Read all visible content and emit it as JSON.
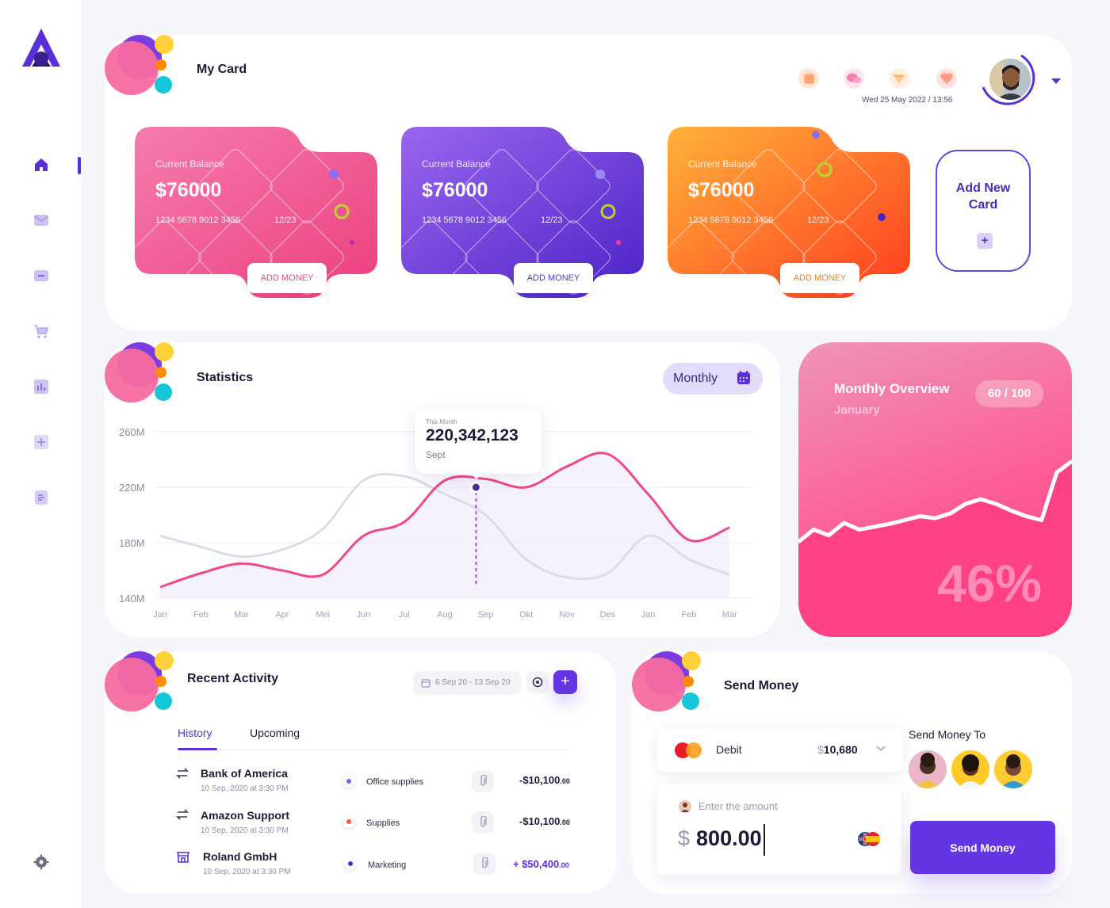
{
  "sidebar": {
    "items": [
      {
        "name": "home",
        "icon": "home-icon"
      },
      {
        "name": "messages",
        "icon": "mail-icon"
      },
      {
        "name": "wallet",
        "icon": "wallet-icon"
      },
      {
        "name": "cart",
        "icon": "cart-icon"
      },
      {
        "name": "analytics",
        "icon": "bar-chart-icon"
      },
      {
        "name": "add",
        "icon": "plus-icon"
      },
      {
        "name": "documents",
        "icon": "document-icon"
      }
    ],
    "settings_icon": "gear-icon"
  },
  "my_card": {
    "title": "My Card",
    "cards": [
      {
        "label": "Current Balance",
        "balance": "$76000",
        "number": "1234 5678 9012 3456",
        "expiry": "12/23",
        "button": "ADD MONEY",
        "accent": "#f0477e"
      },
      {
        "label": "Current Balance",
        "balance": "$76000",
        "number": "1234 5678 9012 3456",
        "expiry": "12/23",
        "button": "ADD MONEY",
        "accent": "#5a2fd8"
      },
      {
        "label": "Current Balance",
        "balance": "$76000",
        "number": "1234 5678 9012 3456",
        "expiry": "12/23",
        "button": "ADD MONEY",
        "accent": "#ff7a1a"
      }
    ],
    "add_new_card": "Add New Card",
    "add_new_card_plus": "+"
  },
  "header": {
    "datetime": "Wed 25 May 2022 / 13:56",
    "icons": [
      "calendar-icon",
      "chat-icon",
      "notification-icon",
      "heart-icon"
    ]
  },
  "statistics": {
    "title": "Statistics",
    "period_button": "Monthly",
    "tooltip": {
      "caption": "This Month",
      "value": "220,342,123",
      "month": "Sept"
    }
  },
  "chart_data": {
    "type": "line",
    "categories": [
      "Jan",
      "Feb",
      "Mar",
      "Apr",
      "Mei",
      "Jun",
      "Jul",
      "Aug",
      "Sep",
      "Okt",
      "Nov",
      "Des",
      "Jan",
      "Feb",
      "Mar"
    ],
    "y_ticks": [
      "260M",
      "220M",
      "180M",
      "140M"
    ],
    "ylim": [
      140,
      260
    ],
    "series": [
      {
        "color": "#f0478c",
        "values": [
          148,
          158,
          165,
          160,
          157,
          185,
          195,
          225,
          226,
          220,
          235,
          244,
          215,
          182,
          191
        ]
      },
      {
        "color": "#dcdce8",
        "values": [
          185,
          177,
          170,
          175,
          190,
          225,
          228,
          215,
          200,
          168,
          155,
          158,
          185,
          168,
          157
        ]
      }
    ],
    "highlight": {
      "category": "Sep",
      "value": 220
    }
  },
  "overview": {
    "title": "Monthly Overview",
    "subtitle": "January",
    "score": "60 / 100",
    "percent": "46%",
    "trend": [
      0.15,
      0.28,
      0.22,
      0.35,
      0.28,
      0.31,
      0.34,
      0.38,
      0.42,
      0.4,
      0.45,
      0.55,
      0.6,
      0.55,
      0.48,
      0.42,
      0.38,
      0.88,
      1.0
    ]
  },
  "recent_activity": {
    "title": "Recent Activity",
    "date_range": "6 Sep 20 - 13 Sep 20",
    "tabs": [
      "History",
      "Upcoming"
    ],
    "rows": [
      {
        "icon": "transfer-icon",
        "name": "Bank of America",
        "date": "10 Sep, 2020 at 3:30 PM",
        "category": "Office supplies",
        "dot": "#8a5cf0",
        "amount": "-$10,100",
        "cents": ".00",
        "color": "#1c1b3a"
      },
      {
        "icon": "transfer-icon",
        "name": "Amazon Support",
        "date": "10 Sep, 2020 at 3:30 PM",
        "category": "Supplies",
        "dot": "#ff5a36",
        "amount": "-$10,100",
        "cents": ".00",
        "color": "#1c1b3a"
      },
      {
        "icon": "store-icon",
        "name": "Roland GmbH",
        "date": "10 Sep, 2020 at 3:30 PM",
        "category": "Marketing",
        "dot": "#4a2fd0",
        "amount": "+ $50,400",
        "cents": ".00",
        "color": "#5a2fd8"
      }
    ]
  },
  "send_money": {
    "title": "Send Money",
    "account_label": "Debit",
    "currency": "$",
    "balance": "10,680",
    "amount_placeholder": "Enter the amount",
    "amount_value": "800.00",
    "send_to_label": "Send Money To",
    "button": "Send Money"
  }
}
